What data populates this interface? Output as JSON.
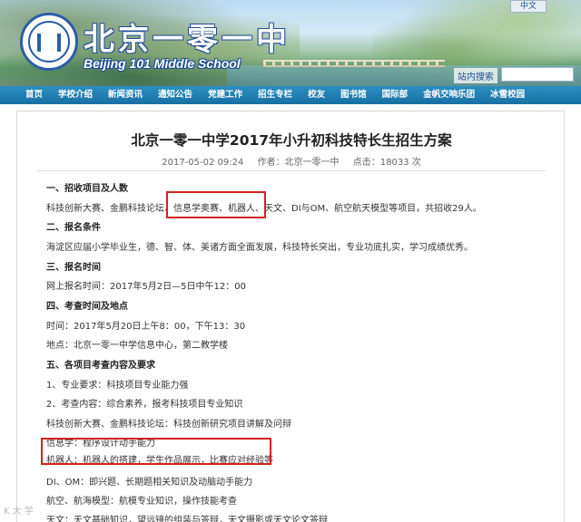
{
  "header": {
    "lang_button": "中文",
    "school_name_cn": "北京一零一中",
    "school_name_en": "Beijing 101 Middle School",
    "search_label": "站内搜索",
    "search_placeholder": ""
  },
  "nav": {
    "items": [
      "首页",
      "学校介绍",
      "新闻资讯",
      "通知公告",
      "党建工作",
      "招生专栏",
      "校友",
      "图书馆",
      "国际部",
      "金帆交响乐团",
      "冰雪校园"
    ]
  },
  "article": {
    "title": "北京一零一中学2017年小升初科技特长生招生方案",
    "date": "2017-05-02 09:24",
    "author": "作者：北京一零一中",
    "views": "点击：18033 次",
    "lines": [
      {
        "text": "一、招收项目及人数",
        "heading": true
      },
      {
        "text": "科技创新大赛、金鹏科技论坛、信息学奥赛、机器人、天文、DI与OM、航空航天模型等项目，共招收29人。",
        "heading": false
      },
      {
        "text": "二、报名条件",
        "heading": true
      },
      {
        "text": "海淀区应届小学毕业生，德、智、体、美诸方面全面发展，科技特长突出，专业功底扎实，学习成绩优秀。",
        "heading": false
      },
      {
        "text": "三、报名时间",
        "heading": true
      },
      {
        "text": "网上报名时间：2017年5月2日—5日中午12：00",
        "heading": false
      },
      {
        "text": "四、考查时间及地点",
        "heading": true
      },
      {
        "text": "时间：2017年5月20日上午8：00，下午13：30",
        "heading": false
      },
      {
        "text": "地点：北京一零一中学信息中心，第二教学楼",
        "heading": false
      },
      {
        "text": "五、各项目考查内容及要求",
        "heading": true
      },
      {
        "text": "1、专业要求：科技项目专业能力强",
        "heading": false
      },
      {
        "text": "2、考查内容：综合素养，报考科技项目专业知识",
        "heading": false
      },
      {
        "text": "科技创新大赛、金鹏科技论坛：科技创新研究项目讲解及问辩",
        "heading": false
      },
      {
        "text": "信息学：程序设计动手能力",
        "heading": false
      },
      {
        "text": "机器人：机器人的搭建，学生作品展示，比赛应对经验等",
        "heading": false
      },
      {
        "text": "DI、OM：即兴题、长期题相关知识及动脑动手能力",
        "heading": false
      },
      {
        "text": "航空、航海模型：航模专业知识，操作技能考查",
        "heading": false
      },
      {
        "text": "天文：天文基础知识，望远镜的组装与答辩，天文摄影或天文论文答辩",
        "heading": false
      }
    ]
  },
  "watermark": "K 大 学"
}
